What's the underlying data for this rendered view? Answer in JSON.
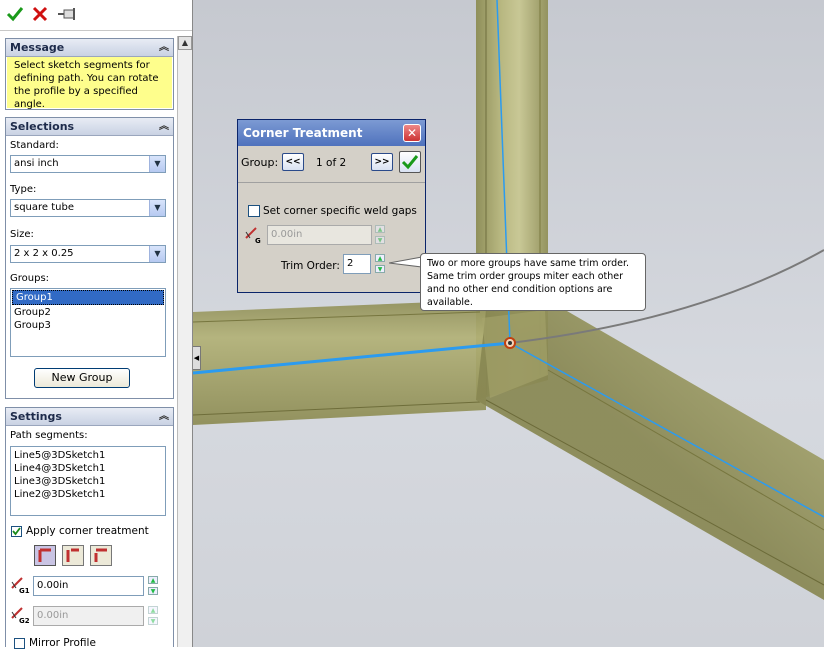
{
  "message": {
    "title": "Message",
    "text": "Select sketch segments for defining path. You can rotate the profile by a specified angle."
  },
  "selections": {
    "title": "Selections",
    "standard_label": "Standard:",
    "standard_value": "ansi inch",
    "type_label": "Type:",
    "type_value": "square tube",
    "size_label": "Size:",
    "size_value": "2 x 2 x 0.25",
    "groups_label": "Groups:",
    "groups": [
      "Group1",
      "Group2",
      "Group3"
    ],
    "selected_group": "Group1",
    "new_group_button": "New Group"
  },
  "settings": {
    "title": "Settings",
    "path_segments_label": "Path segments:",
    "path_segments": [
      "Line5@3DSketch1",
      "Line4@3DSketch1",
      "Line3@3DSketch1",
      "Line2@3DSketch1"
    ],
    "apply_corner_label": "Apply corner treatment",
    "apply_corner_checked": true,
    "gap1_value": "0.00in",
    "gap2_value": "0.00in",
    "gap1_sub": "G1",
    "gap2_sub": "G2",
    "mirror_label": "Mirror Profile"
  },
  "corner_dialog": {
    "title": "Corner Treatment",
    "group_label": "Group:",
    "prev_label": "<<",
    "next_label": ">>",
    "group_position": "1 of 2",
    "weld_gap_label": "Set corner specific weld gaps",
    "weld_gap_checked": false,
    "gap_value": "0.00in",
    "gap_sub": "G",
    "trim_order_label": "Trim Order:",
    "trim_order_value": "2"
  },
  "tooltip": {
    "text": "Two or more groups have same trim order. Same trim order groups miter each other and no other end condition options are available."
  },
  "icons": {
    "ok": "check-icon",
    "cancel": "close-icon",
    "pin": "pushpin-icon"
  },
  "colors": {
    "tube": "#a9a868",
    "sketch_line": "#2b9bf0",
    "message_bg": "#fefe8c",
    "selected": "#316ac5"
  }
}
